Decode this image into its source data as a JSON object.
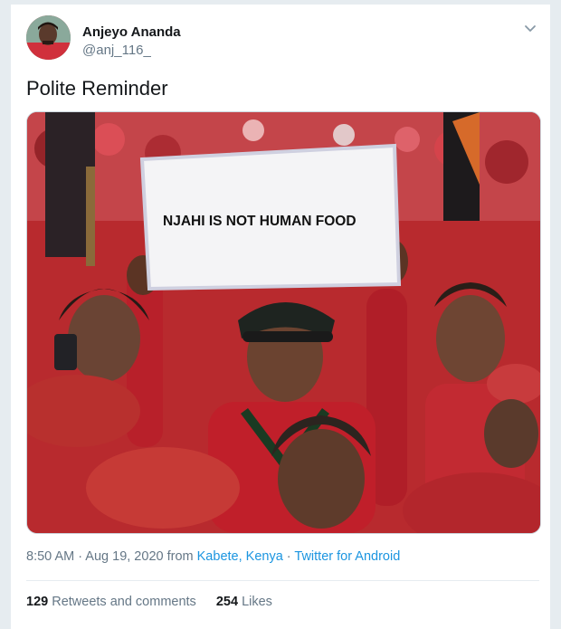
{
  "tweet": {
    "author": {
      "display_name": "Anjeyo Ananda",
      "handle": "@anj_116_"
    },
    "text": "Polite Reminder",
    "media": {
      "sign_text": "NJAHI IS NOT HUMAN FOOD"
    },
    "meta": {
      "time": "8:50 AM",
      "separator1": " · ",
      "date": "Aug 19, 2020",
      "from_label": " from ",
      "location": "Kabete, Kenya",
      "separator2": " · ",
      "source": "Twitter for Android"
    },
    "stats": {
      "retweets_count": "129",
      "retweets_label": " Retweets and comments",
      "likes_count": "254",
      "likes_label": " Likes"
    }
  },
  "colors": {
    "link": "#1b95e0",
    "secondary_text": "#657786",
    "primary_text": "#14171a",
    "crowd_red": "#c4252d"
  },
  "icons": {
    "caret": "chevron-down-icon"
  }
}
